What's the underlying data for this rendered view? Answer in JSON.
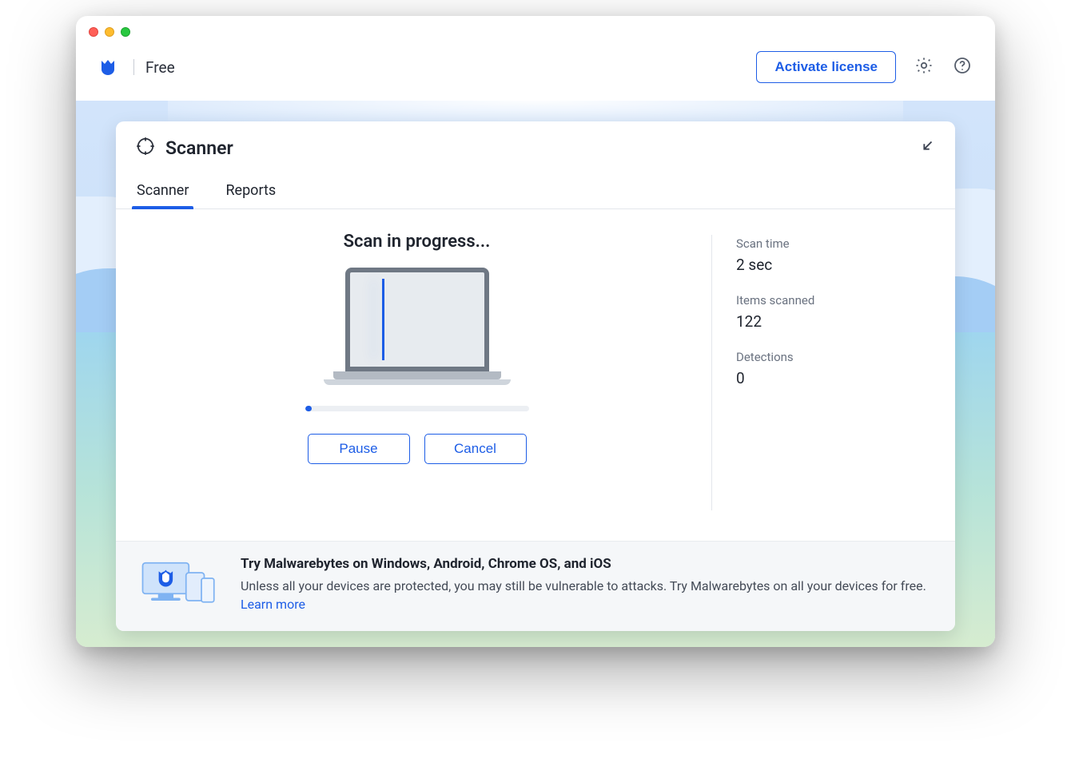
{
  "header": {
    "tier_label": "Free",
    "activate_label": "Activate license"
  },
  "card": {
    "title": "Scanner"
  },
  "tabs": {
    "scanner": "Scanner",
    "reports": "Reports"
  },
  "scan": {
    "title": "Scan in progress...",
    "pause_label": "Pause",
    "cancel_label": "Cancel",
    "progress_percent": 3
  },
  "stats": {
    "scan_time_label": "Scan time",
    "scan_time_value": "2 sec",
    "items_scanned_label": "Items scanned",
    "items_scanned_value": "122",
    "detections_label": "Detections",
    "detections_value": "0"
  },
  "promo": {
    "title": "Try Malwarebytes on Windows, Android, Chrome OS, and iOS",
    "body": "Unless all your devices are protected, you may still be vulnerable to attacks. Try Malwarebytes on all your devices for free. ",
    "learn_more": "Learn more"
  }
}
